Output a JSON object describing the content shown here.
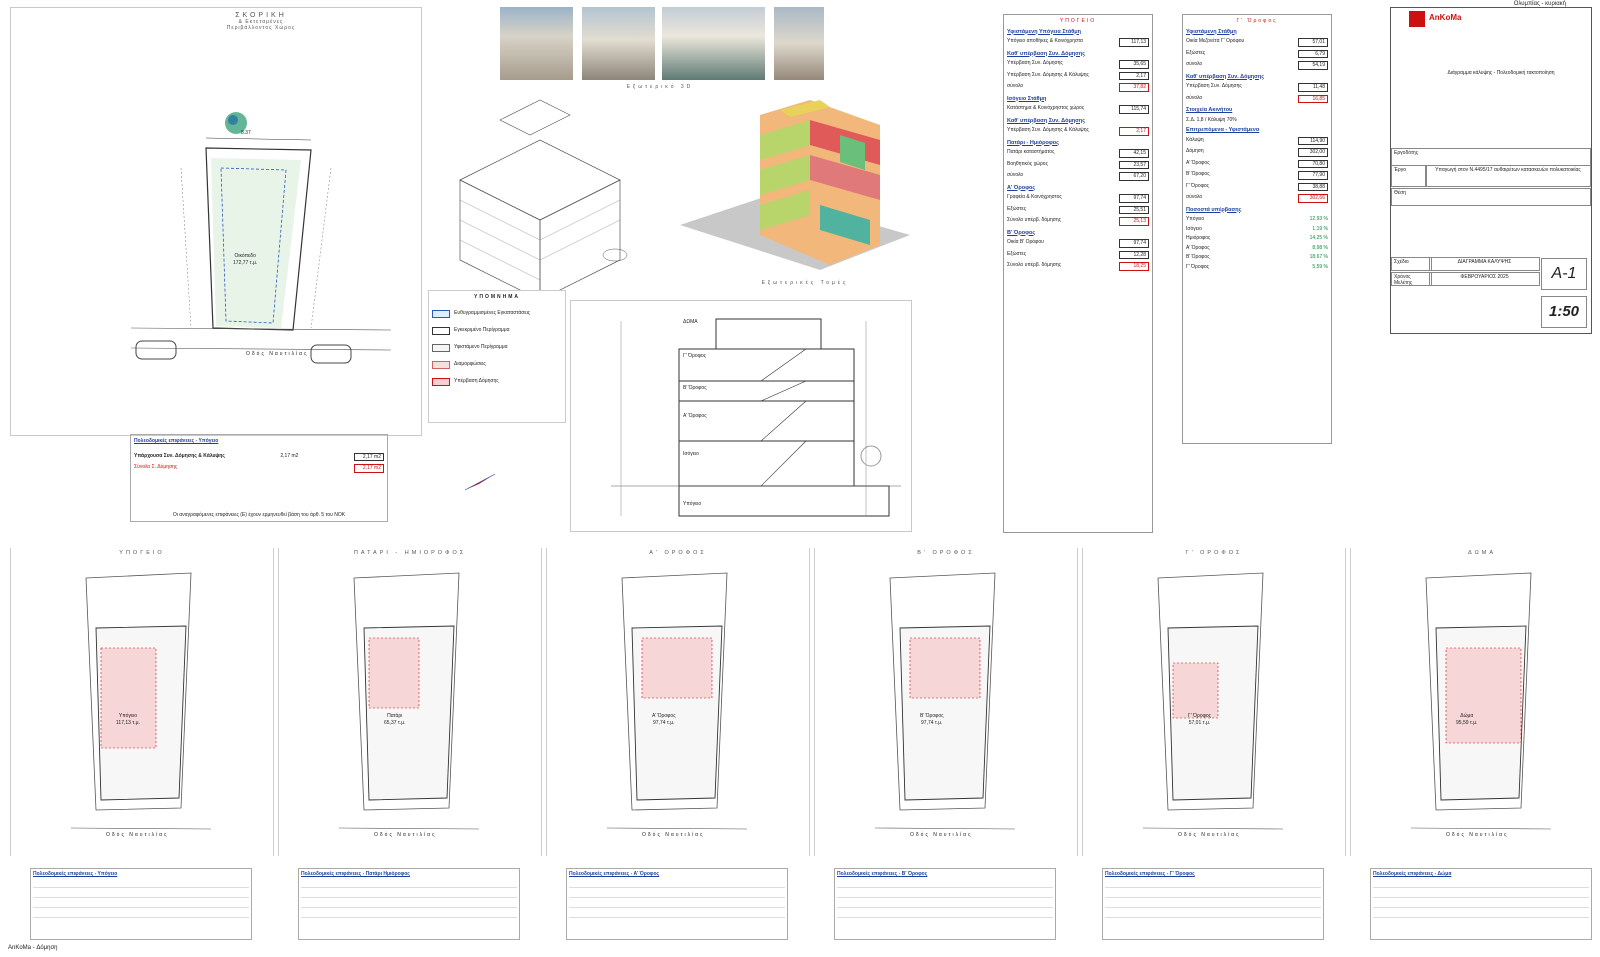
{
  "header": {
    "top_right": "Ολυμπίας - κυριακή"
  },
  "footer": {
    "left": "AnKoMa - Δόμηση"
  },
  "siteplan": {
    "title_l1": "ΣΚΟΡΙΚΗ",
    "title_l2": "& Εκτεταμένες",
    "title_l3": "Περιβάλλοντος Χώρος",
    "street": "Οδός Ναυτιλίας",
    "dim_top": "8.37",
    "plot_label": "Οικόπεδο",
    "plot_area": "172,77 τ.μ."
  },
  "calc_box": {
    "title": "Πολεοδομικές επιφάνειες - Υπόγειο",
    "line1_label": "Υπάρχουσα Συν. Δόμησης & Κάλυψης",
    "line1_val": "2,17 m2",
    "box1": "2,17 m2",
    "box2": "2,17 m2",
    "sum_label": "Σύνολο Σ. Δόμησης",
    "note": "Οι αναγραφόμενες επιφάνειες (Ε) έχουν ερμηνευθεί βάση του άρθ. 5 του ΝΟΚ"
  },
  "photos": {
    "caption": "Εξωτερικό 3D"
  },
  "iso_caption": "Εξωτερικές Τομές",
  "legend": {
    "title": "ΥΠΟΜΝΗΜΑ",
    "items": [
      "Ευθυγραμμισμένες Εγκαταστάσεις",
      "Εγκεκριμένο Περίγραμμα",
      "Υφιστάμενο Περίγραμμα",
      "Διαμορφώσεις",
      "Υπέρβαση Δόμησης"
    ]
  },
  "section": {
    "labels": [
      "ΔΩΜΑ",
      "Γ' Όροφος",
      "Β' Όροφος",
      "Α' Όροφος",
      "Ισόγειο",
      "Υπόγειο"
    ]
  },
  "table_mid": {
    "title": "ΥΠΟΓΕΙΟ",
    "rows": [
      {
        "t": "sec",
        "label": "Υφιστάμενη Υπόγεια Στάθμη"
      },
      {
        "t": "val",
        "label": "Υπόγειο αποθήκες & Κοινόχρηστα",
        "v": "117,13",
        "c": "box"
      },
      {
        "t": "sec",
        "label": "Καθ' υπέρβαση Συν. Δόμησης"
      },
      {
        "t": "val",
        "label": "Υπέρβαση Συν. Δόμησης",
        "v": "35,65",
        "c": "box"
      },
      {
        "t": "val",
        "label": "Υπέρβαση Συν. Δόμησης & Κάλυψης",
        "v": "2,17",
        "c": "box"
      },
      {
        "t": "val",
        "label": "σύνολο",
        "v": "37,82",
        "c": "boxr"
      },
      {
        "t": "sec",
        "label": "Ισόγειο Στάθμη"
      },
      {
        "t": "val",
        "label": "Κατάστημα & Κοινόχρηστος χώρος",
        "v": "115,74",
        "c": "box"
      },
      {
        "t": "sec",
        "label": "Καθ' υπέρβαση Συν. Δόμησης"
      },
      {
        "t": "val",
        "label": "Υπέρβαση Συν. Δόμησης & Κάλυψης",
        "v": "2,17",
        "c": "boxr"
      },
      {
        "t": "sec",
        "label": "Πατάρι - Ημιόροφος"
      },
      {
        "t": "val",
        "label": "Πατάρι καταστήματος",
        "v": "42,15",
        "c": "box"
      },
      {
        "t": "val",
        "label": "Βοηθητικός χώρος",
        "v": "23,57",
        "c": "box"
      },
      {
        "t": "val",
        "label": "σύνολο",
        "v": "67,20",
        "c": "box"
      },
      {
        "t": "sec",
        "label": "Α' Όροφος"
      },
      {
        "t": "val",
        "label": "Γραφεία & Κοινόχρηστος",
        "v": "97,74",
        "c": "box"
      },
      {
        "t": "val",
        "label": "Εξώστες",
        "v": "25,51",
        "c": "box"
      },
      {
        "t": "val",
        "label": "Σύνολο υπέρβ. δόμησης",
        "v": "25,13",
        "c": "boxr"
      },
      {
        "t": "sec",
        "label": "Β' Όροφος"
      },
      {
        "t": "val",
        "label": "Οικία Β' Ορόφου",
        "v": "97,74",
        "c": "box"
      },
      {
        "t": "val",
        "label": "Εξώστες",
        "v": "12,28",
        "c": "box"
      },
      {
        "t": "val",
        "label": "Σύνολο υπέρβ. δόμησης",
        "v": "18,25",
        "c": "boxr"
      }
    ]
  },
  "table_right": {
    "title": "Γ' Όροφος",
    "rows": [
      {
        "t": "sec",
        "label": "Υφιστάμενη Στάθμη"
      },
      {
        "t": "val",
        "label": "Οικία Μεζονέτα Γ' Ορόφου",
        "v": "57,01",
        "c": "box"
      },
      {
        "t": "val",
        "label": "Εξώστες",
        "v": "6,79",
        "c": "box"
      },
      {
        "t": "val",
        "label": "σύνολο",
        "v": "54,19",
        "c": "box"
      },
      {
        "t": "sec",
        "label": "Καθ' υπέρβαση Συν. Δόμησης"
      },
      {
        "t": "val",
        "label": "Υπέρβαση Συν. Δόμησης",
        "v": "11,48",
        "c": "box"
      },
      {
        "t": "val",
        "label": "σύνολο",
        "v": "16,85",
        "c": "boxr"
      },
      {
        "t": "sec",
        "label": "Στοιχεία Ακινήτου"
      },
      {
        "t": "val",
        "label": "Σ.Δ. 1,8 / Κάλυψη 70%",
        "v": "",
        "c": ""
      },
      {
        "t": "sec",
        "label": "Επιτρεπόμενα - Υφιστάμενα"
      },
      {
        "t": "val",
        "label": "Κάλυψη",
        "v": "114,90",
        "c": "box"
      },
      {
        "t": "val",
        "label": "Δόμηση",
        "v": "302,00",
        "c": "box"
      },
      {
        "t": "val",
        "label": "Α' Όροφος",
        "v": "70,80",
        "c": "box"
      },
      {
        "t": "val",
        "label": "Β' Όροφος",
        "v": "77,90",
        "c": "box"
      },
      {
        "t": "val",
        "label": "Γ' Όροφος",
        "v": "38,88",
        "c": "box"
      },
      {
        "t": "val",
        "label": "σύνολο",
        "v": "302,66",
        "c": "boxr"
      },
      {
        "t": "sec",
        "label": "Ποσοστά υπέρβασης"
      },
      {
        "t": "val",
        "label": "Υπόγειο",
        "v": "12,93 %",
        "c": "green"
      },
      {
        "t": "val",
        "label": "Ισόγειο",
        "v": "1,19 %",
        "c": "green"
      },
      {
        "t": "val",
        "label": "Ημιόροφος",
        "v": "14,25 %",
        "c": "green"
      },
      {
        "t": "val",
        "label": "Α' Όροφος",
        "v": "8,98 %",
        "c": "green"
      },
      {
        "t": "val",
        "label": "Β' Όροφος",
        "v": "18,67 %",
        "c": "green"
      },
      {
        "t": "val",
        "label": "Γ' Όροφος",
        "v": "5,59 %",
        "c": "green"
      }
    ]
  },
  "title_block": {
    "company": "AnKoMa",
    "subtitle": "Διάγραμμα κάλυψης - Πολεοδομική τακτοποίηση",
    "field_owner": "Εργοδότης",
    "field_project": "Έργο",
    "field_location": "Θέση",
    "field_drawing": "Σχέδιο",
    "drawing_name": "ΔΙΑΓΡΑΜΜΑ ΚΑΛΥΨΗΣ",
    "field_date": "Χρόνος Μελέτης",
    "date": "ΦΕΒΡΟΥΑΡΙΟΣ 2025",
    "code": "Α-1",
    "scale": "1:50",
    "project_desc": "Υπαγωγή στον Ν.4495/17 αυθαιρέτων κατασκευών πολυκατοικίας"
  },
  "plans": [
    {
      "title": "ΥΠΟΓΕΙΟ",
      "room": "Υπόγειο",
      "area": "117,13 τ.μ.",
      "calc_title": "Πολεοδομικές επιφάνειες - Υπόγειο"
    },
    {
      "title": "ΠΑΤΑΡΙ - ΗΜΙΟΡΟΦΟΣ",
      "room": "Πατάρι",
      "area": "65,37 τ.μ.",
      "calc_title": "Πολεοδομικές επιφάνειες - Πατάρι Ημιόροφος"
    },
    {
      "title": "Α' ΟΡΟΦΟΣ",
      "room": "Α' Όροφος",
      "area": "97,74 τ.μ.",
      "calc_title": "Πολεοδομικές επιφάνειες - Α' Όροφος"
    },
    {
      "title": "Β' ΟΡΟΦΟΣ",
      "room": "Β' Όροφος",
      "area": "97,74 τ.μ.",
      "calc_title": "Πολεοδομικές επιφάνειες - Β' Όροφος"
    },
    {
      "title": "Γ' ΟΡΟΦΟΣ",
      "room": "Γ' Όροφος",
      "area": "57,01 τ.μ.",
      "calc_title": "Πολεοδομικές επιφάνειες - Γ' Όροφος"
    },
    {
      "title": "ΔΩΜΑ",
      "room": "Δώμα",
      "area": "95,59 τ.μ.",
      "calc_title": "Πολεοδομικές επιφάνειες - Δώμα"
    }
  ],
  "plan_street": "Οδός Ναυτιλίας"
}
